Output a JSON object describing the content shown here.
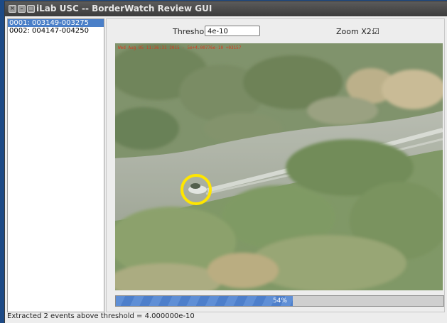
{
  "window": {
    "title": "iLab USC -- BorderWatch Review GUI",
    "buttons": [
      "close",
      "minimize",
      "maximize"
    ]
  },
  "sidebar": {
    "items": [
      {
        "label": "0001: 003149-003275",
        "selected": true
      },
      {
        "label": "0002: 004147-004250",
        "selected": false
      }
    ]
  },
  "controls": {
    "threshold_label": "Threshold:",
    "threshold_value": "4e-10",
    "zoom_label": "Zoom X2:",
    "zoom_checked": true,
    "zoom_check_glyph": "☑"
  },
  "video": {
    "overlay_text": "Wed Aug 05 11:36:31 2015 - 5e+4.00776e-10 +03157",
    "marker": "yellow circle around boat"
  },
  "progress": {
    "percent": 54,
    "label": "54%"
  },
  "status": {
    "text": "Extracted 2 events above threshold = 4.000000e-10"
  },
  "colors": {
    "selection": "#4a7fc8",
    "progress": "#5f8fd6",
    "marker": "#ffe600",
    "overlay_text": "#d83a1f"
  }
}
